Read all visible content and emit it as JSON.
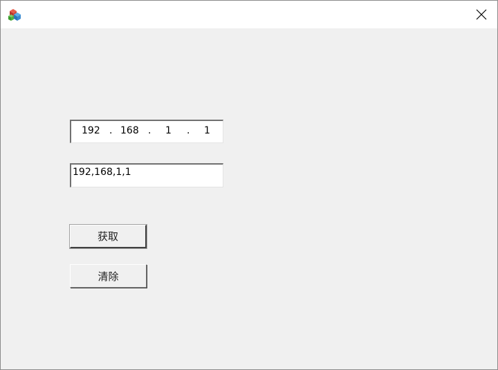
{
  "window": {
    "icon": "app-cubes-icon",
    "close_icon": "close-icon"
  },
  "ip_address": {
    "octet1": "192",
    "octet2": "168",
    "octet3": "1",
    "octet4": "1",
    "separator": "."
  },
  "result_field": {
    "value": "192,168,1,1"
  },
  "buttons": {
    "get_label": "获取",
    "clear_label": "清除"
  }
}
